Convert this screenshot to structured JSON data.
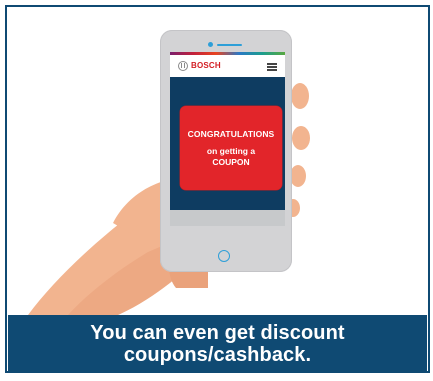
{
  "phone": {
    "brand": "BOSCH",
    "coupon": {
      "line1": "CONGRATULATIONS",
      "line2": "on getting a",
      "line3": "COUPON"
    }
  },
  "caption": {
    "line1": "You can even get discount",
    "line2": "coupons/cashback."
  },
  "colors": {
    "brand_red": "#e2252a",
    "navy": "#0f4a73",
    "screen_blue": "#0e3c61",
    "accent_blue": "#2e9fd8"
  }
}
